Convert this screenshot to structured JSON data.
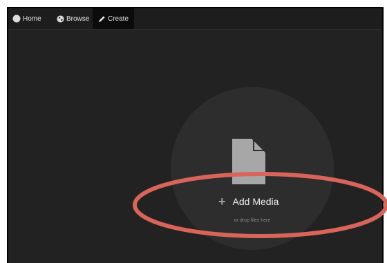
{
  "nav": {
    "items": [
      {
        "label": "Home",
        "icon": "circle-icon"
      },
      {
        "label": "Browse",
        "icon": "globe-icon"
      },
      {
        "label": "Create",
        "icon": "pencil-icon",
        "active": true
      }
    ]
  },
  "upload": {
    "icon": "file-icon",
    "add_media_label": "Add Media",
    "drop_hint": "or drop files here"
  },
  "annotation": {
    "shape": "ellipse",
    "color": "#d9645a"
  },
  "colors": {
    "background": "#222222",
    "topbar": "#1d1d1d",
    "active_tab": "#0b0b0b",
    "circle": "#2d2d2d",
    "file_icon": "#a7a7a7"
  }
}
